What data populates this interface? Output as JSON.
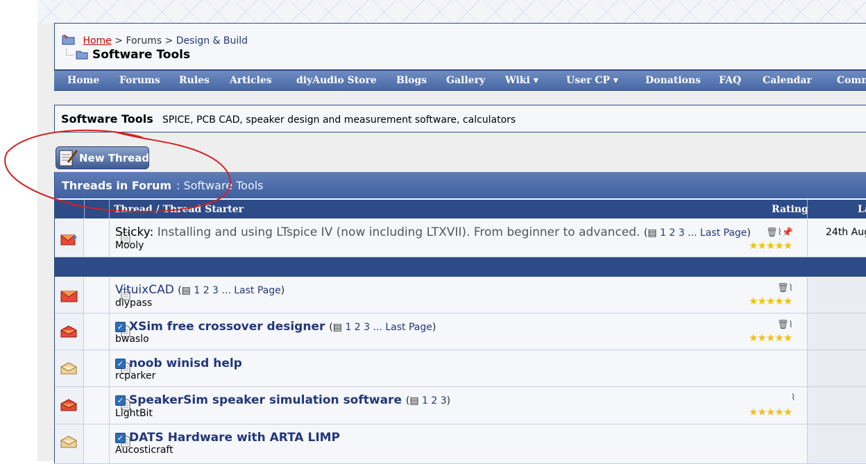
{
  "breadcrumb": {
    "home": "Home",
    "sep1": ">",
    "forums": "Forums",
    "sep2": ">",
    "section": "Design & Build",
    "current": "Software Tools"
  },
  "menu": [
    {
      "label": "Home"
    },
    {
      "label": "Forums"
    },
    {
      "label": "Rules"
    },
    {
      "label": "Articles"
    },
    {
      "label": "diyAudio Store"
    },
    {
      "label": "Blogs"
    },
    {
      "label": "Gallery"
    },
    {
      "label": "Wiki ▾"
    },
    {
      "label": "User CP ▾"
    },
    {
      "label": "Donations"
    },
    {
      "label": "FAQ"
    },
    {
      "label": "Calendar"
    },
    {
      "label": "Comm"
    }
  ],
  "forum": {
    "title": "Software Tools",
    "description": "SPICE, PCB CAD, speaker design and measurement software, calculators"
  },
  "new_thread_label": "New Thread",
  "table": {
    "heading": "Threads in Forum",
    "heading_forum": ": Software Tools",
    "col_thread": "Thread / Thread Starter",
    "col_rating": "Rating",
    "col_last": "La"
  },
  "sticky": {
    "prefix": "Sticky:",
    "title": "Installing and using LTspice IV (now including LTXVII). From beginner to advanced.",
    "pages": "1 2 3 ...",
    "last_page": "Last Page",
    "starter": "Mooly",
    "last_post": "24th Aug",
    "rating": "★★★★★"
  },
  "threads": [
    {
      "title": "VituixCAD",
      "pages": "1 2 3 ...",
      "last_page": "Last Page",
      "starter": "diypass",
      "rating": "★★★★★"
    },
    {
      "title": "XSim free crossover designer",
      "pages": "1 2 3 ...",
      "last_page": "Last Page",
      "starter": "bwaslo",
      "rating": "★★★★★"
    },
    {
      "title": "noob winisd help",
      "starter": "rcparker"
    },
    {
      "title": "SpeakerSim speaker simulation software",
      "pages": "1 2 3",
      "starter": "LightBit",
      "rating": "★★★★★"
    },
    {
      "title": "DATS Hardware with ARTA LIMP",
      "starter": "Aucosticraft"
    }
  ],
  "colors": {
    "menubar": "#4968a6",
    "header_dark": "#2d4b87",
    "link": "#22377a",
    "annotation": "#d42020"
  }
}
